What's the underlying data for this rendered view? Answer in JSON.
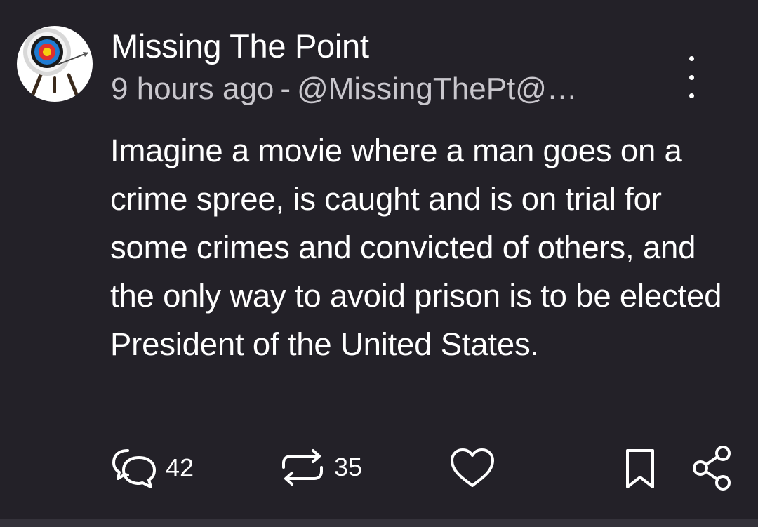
{
  "post": {
    "author_name": "Missing The Point",
    "time_ago": "9 hours ago",
    "separator": "-",
    "handle": "@MissingThePt@…",
    "body_text": "Imagine a movie where a man goes on a crime spree, is caught and is on trial for some crimes and convicted of others, and the only way to avoid prison is to be elected President of the United States."
  },
  "actions": {
    "replies_count": "42",
    "boosts_count": "35"
  },
  "icons": {
    "avatar": "archery-target-icon",
    "more": "more-vertical-icon",
    "reply": "reply-icon",
    "boost": "boost-icon",
    "favourite": "heart-icon",
    "bookmark": "bookmark-icon",
    "share": "share-icon"
  },
  "colors": {
    "background": "#232128",
    "text_primary": "#ffffff",
    "text_secondary": "#c9c7cd"
  }
}
